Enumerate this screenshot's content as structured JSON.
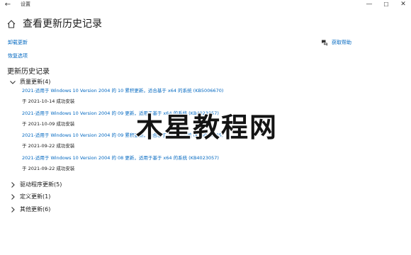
{
  "window": {
    "title": "设置",
    "back": "←",
    "minimize": "—",
    "maximize": "☐",
    "close": "✕"
  },
  "page_title": "查看更新历史记录",
  "links": {
    "uninstall": "卸载更新",
    "recovery": "恢复选项",
    "help": "获取帮助"
  },
  "section_heading": "更新历史记录",
  "groups": {
    "quality": "质量更新(4)",
    "driver": "驱动程序更新(5)",
    "definition": "定义更新(1)",
    "other": "其他更新(6)"
  },
  "updates": [
    {
      "title": "2021-适用于 Windows 10 Version 2004 的 10 累积更新，适合基于 x64 的系统 (KB5006670)",
      "status": "于 2021-10-14 成功安装"
    },
    {
      "title": "2021-适用于 Windows 10 Version 2004 的 09 更新，适用于基于 x64 的系统 (KB4023057)",
      "status": "于 2021-10-09 成功安装"
    },
    {
      "title": "2021-适用于 Windows 10 Version 2004 的 09 累积更新，适合基于 x64 的系统 (KB5005565)",
      "status": "于 2021-09-22 成功安装"
    },
    {
      "title": "2021-适用于 Windows 10 Version 2004 的 08 更新，适用于基于 x64 的系统 (KB4023057)",
      "status": "于 2021-09-22 成功安装"
    }
  ],
  "watermark": {
    "text": "木星教程网"
  },
  "colors": {
    "link": "#0067c0",
    "text": "#1a1a1a",
    "background": "#ffffff"
  }
}
